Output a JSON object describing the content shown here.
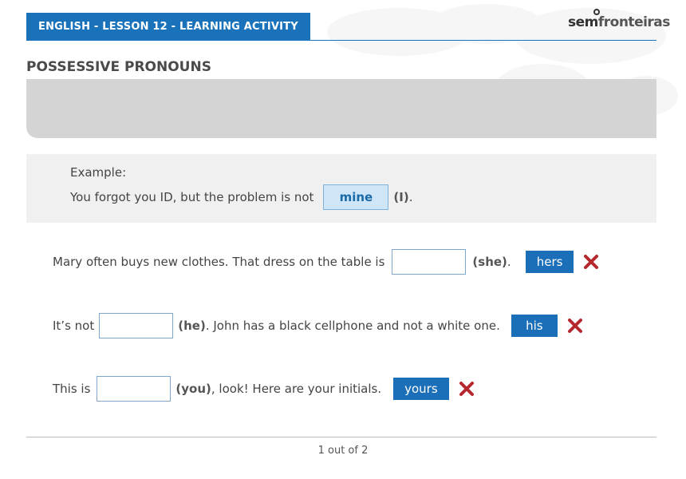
{
  "header": {
    "title": "ENGLISH - LESSON 12 - LEARNING ACTIVITY",
    "logo_part1": "sem",
    "logo_part2": "fronteiras"
  },
  "page": {
    "title": "POSSESSIVE PRONOUNS"
  },
  "example": {
    "label": "Example:",
    "sentence_before": "You forgot you ID, but the problem is not",
    "answer": "mine",
    "hint": "(I)",
    "after": "."
  },
  "questions": [
    {
      "before": "Mary often buys new clothes. That dress on the table is",
      "hint": "(she)",
      "after": ".",
      "answer": "hers"
    },
    {
      "before": "It’s not",
      "hint": "(he)",
      "after": ". John has a black cellphone and not a white one.",
      "answer": "his"
    },
    {
      "before": "This is",
      "hint": "(you)",
      "after": ", look! Here are your initials.",
      "answer": "yours"
    }
  ],
  "pager": {
    "text": "1 out of 2"
  },
  "colors": {
    "primary": "#1a73ba",
    "wrong": "#b5282e",
    "answer_bg": "#cfe6f8"
  }
}
